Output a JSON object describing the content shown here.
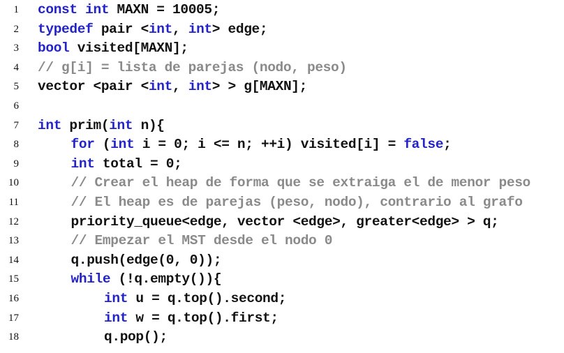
{
  "colors": {
    "keyword": "#2323c8",
    "comment": "#8a8a8a",
    "text": "#111111",
    "background": "#ffffff"
  },
  "lines": [
    {
      "num": "1",
      "indent": 0,
      "segments": [
        {
          "type": "kw",
          "text": "const int"
        },
        {
          "type": "tx",
          "text": " MAXN = 10005;"
        }
      ]
    },
    {
      "num": "2",
      "indent": 0,
      "segments": [
        {
          "type": "kw",
          "text": "typedef"
        },
        {
          "type": "tx",
          "text": " pair <"
        },
        {
          "type": "kw",
          "text": "int"
        },
        {
          "type": "tx",
          "text": ", "
        },
        {
          "type": "kw",
          "text": "int"
        },
        {
          "type": "tx",
          "text": "> edge;"
        }
      ]
    },
    {
      "num": "3",
      "indent": 0,
      "segments": [
        {
          "type": "kw",
          "text": "bool"
        },
        {
          "type": "tx",
          "text": " visited[MAXN];"
        }
      ]
    },
    {
      "num": "4",
      "indent": 0,
      "segments": [
        {
          "type": "cm",
          "text": "// g[i] = lista de parejas (nodo, peso)"
        }
      ]
    },
    {
      "num": "5",
      "indent": 0,
      "segments": [
        {
          "type": "tx",
          "text": "vector <pair <"
        },
        {
          "type": "kw",
          "text": "int"
        },
        {
          "type": "tx",
          "text": ", "
        },
        {
          "type": "kw",
          "text": "int"
        },
        {
          "type": "tx",
          "text": "> > g[MAXN];"
        }
      ]
    },
    {
      "num": "6",
      "indent": 0,
      "segments": []
    },
    {
      "num": "7",
      "indent": 0,
      "segments": [
        {
          "type": "kw",
          "text": "int"
        },
        {
          "type": "tx",
          "text": " prim("
        },
        {
          "type": "kw",
          "text": "int"
        },
        {
          "type": "tx",
          "text": " n){"
        }
      ]
    },
    {
      "num": "8",
      "indent": 1,
      "segments": [
        {
          "type": "kw",
          "text": "for"
        },
        {
          "type": "tx",
          "text": " ("
        },
        {
          "type": "kw",
          "text": "int"
        },
        {
          "type": "tx",
          "text": " i = 0; i <= n; ++i) visited[i] = "
        },
        {
          "type": "kw",
          "text": "false"
        },
        {
          "type": "tx",
          "text": ";"
        }
      ]
    },
    {
      "num": "9",
      "indent": 1,
      "segments": [
        {
          "type": "kw",
          "text": "int"
        },
        {
          "type": "tx",
          "text": " total = 0;"
        }
      ]
    },
    {
      "num": "10",
      "indent": 1,
      "segments": [
        {
          "type": "cm",
          "text": "// Crear el heap de forma que se extraiga el de menor peso"
        }
      ]
    },
    {
      "num": "11",
      "indent": 1,
      "segments": [
        {
          "type": "cm",
          "text": "// El heap es de parejas (peso, nodo), contrario al grafo"
        }
      ]
    },
    {
      "num": "12",
      "indent": 1,
      "segments": [
        {
          "type": "tx",
          "text": "priority_queue<edge, vector <edge>, greater<edge> > q;"
        }
      ]
    },
    {
      "num": "13",
      "indent": 1,
      "segments": [
        {
          "type": "cm",
          "text": "// Empezar el MST desde el nodo 0"
        }
      ]
    },
    {
      "num": "14",
      "indent": 1,
      "segments": [
        {
          "type": "tx",
          "text": "q.push(edge(0, 0));"
        }
      ]
    },
    {
      "num": "15",
      "indent": 1,
      "segments": [
        {
          "type": "kw",
          "text": "while"
        },
        {
          "type": "tx",
          "text": " (!q.empty()){"
        }
      ]
    },
    {
      "num": "16",
      "indent": 2,
      "segments": [
        {
          "type": "kw",
          "text": "int"
        },
        {
          "type": "tx",
          "text": " u = q.top().second;"
        }
      ]
    },
    {
      "num": "17",
      "indent": 2,
      "segments": [
        {
          "type": "kw",
          "text": "int"
        },
        {
          "type": "tx",
          "text": " w = q.top().first;"
        }
      ]
    },
    {
      "num": "18",
      "indent": 2,
      "segments": [
        {
          "type": "tx",
          "text": "q.pop();"
        }
      ]
    }
  ]
}
